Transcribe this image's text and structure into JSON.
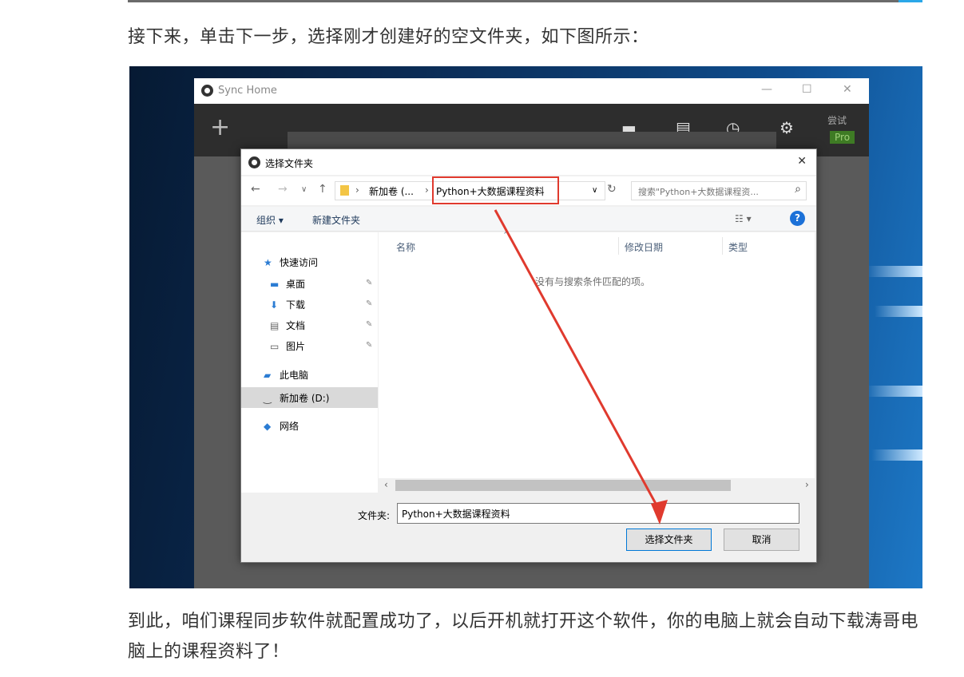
{
  "article": {
    "para1": "接下来，单击下一步，选择刚才创建好的空文件夹，如下图所示：",
    "para2": "到此，咱们课程同步软件就配置成功了，以后开机就打开这个软件，你的电脑上就会自动下载涛哥电脑上的课程资料了！"
  },
  "sync_window": {
    "title": "Sync Home",
    "minimize": "—",
    "maximize": "☐",
    "close": "✕",
    "add": "+",
    "trial": "尝试",
    "pro": "Pro"
  },
  "dialog": {
    "title": "选择文件夹",
    "close": "✕",
    "breadcrumb": {
      "drive": "新加卷 (...",
      "folder": "Python+大数据课程资料"
    },
    "search_placeholder": "搜索\"Python+大数据课程资...",
    "commands": {
      "organize": "组织 ▾",
      "new_folder": "新建文件夹"
    },
    "nav": {
      "quick_access": "快速访问",
      "desktop": "桌面",
      "downloads": "下载",
      "documents": "文档",
      "pictures": "图片",
      "this_pc": "此电脑",
      "new_volume": "新加卷 (D:)",
      "network": "网络"
    },
    "columns": {
      "name": "名称",
      "date": "修改日期",
      "type": "类型"
    },
    "empty_message": "没有与搜索条件匹配的项。",
    "folder_label": "文件夹:",
    "folder_value": "Python+大数据课程资料",
    "select_button": "选择文件夹",
    "cancel_button": "取消"
  },
  "colors": {
    "highlight": "#e03a2e",
    "arrow": "#e03a2e",
    "help": "#1c71d8"
  }
}
